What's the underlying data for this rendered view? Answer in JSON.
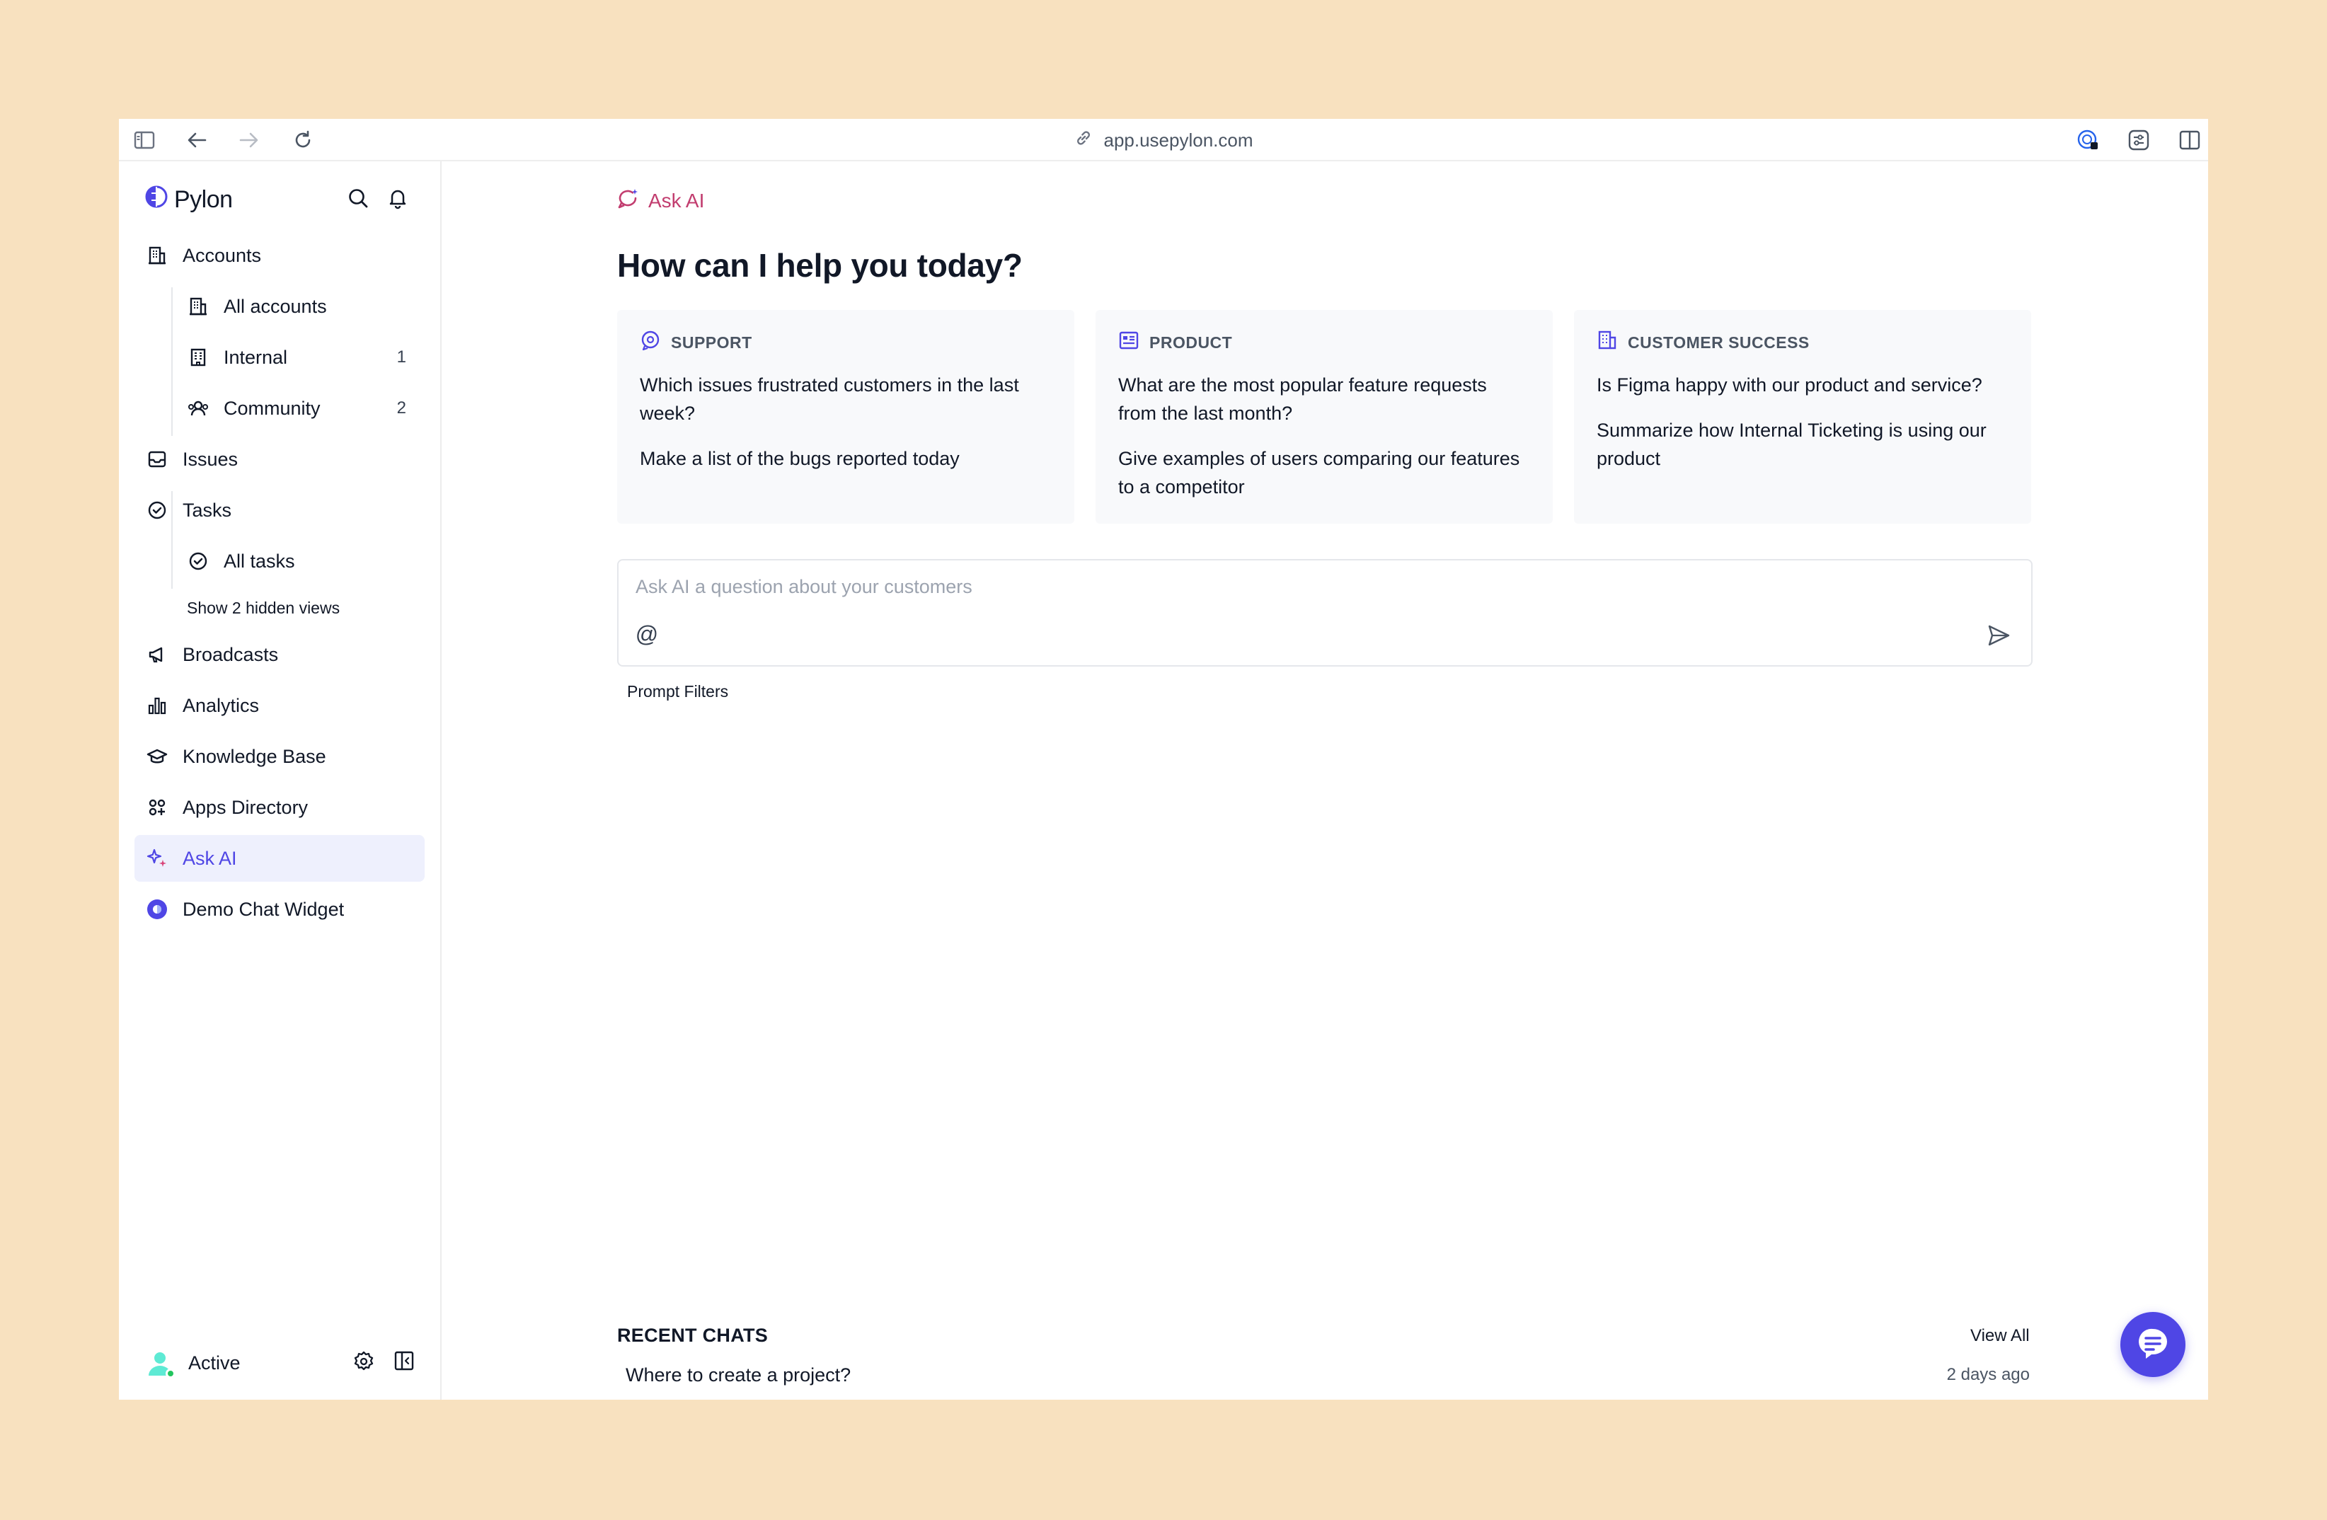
{
  "browser": {
    "url": "app.usepylon.com"
  },
  "sidebar": {
    "brand": "Pylon",
    "items": [
      {
        "label": "Accounts",
        "icon": "building-icon"
      },
      {
        "label": "All accounts",
        "icon": "building-icon"
      },
      {
        "label": "Internal",
        "icon": "office-icon",
        "count": "1"
      },
      {
        "label": "Community",
        "icon": "community-icon",
        "count": "2"
      },
      {
        "label": "Issues",
        "icon": "inbox-icon"
      },
      {
        "label": "Tasks",
        "icon": "check-circle-icon"
      },
      {
        "label": "All tasks",
        "icon": "check-circle-icon"
      },
      {
        "label": "Broadcasts",
        "icon": "megaphone-icon"
      },
      {
        "label": "Analytics",
        "icon": "bar-chart-icon"
      },
      {
        "label": "Knowledge Base",
        "icon": "graduation-cap-icon"
      },
      {
        "label": "Apps Directory",
        "icon": "apps-icon"
      },
      {
        "label": "Ask AI",
        "icon": "sparkles-icon"
      },
      {
        "label": "Demo Chat Widget",
        "icon": "chat-widget-icon"
      }
    ],
    "hidden_views": "Show 2 hidden views",
    "footer": {
      "status": "Active"
    }
  },
  "main": {
    "breadcrumb": "Ask AI",
    "headline": "How can I help you today?",
    "cards": [
      {
        "category": "SUPPORT",
        "questions": [
          "Which issues frustrated customers in the last week?",
          "Make a list of the bugs reported today"
        ]
      },
      {
        "category": "PRODUCT",
        "questions": [
          "What are the most popular feature requests from the last month?",
          "Give examples of users comparing our features to a competitor"
        ]
      },
      {
        "category": "CUSTOMER SUCCESS",
        "questions": [
          "Is Figma happy with our product and service?",
          "Summarize how Internal Ticketing is using our product"
        ]
      }
    ],
    "ask": {
      "placeholder": "Ask AI a question about your customers",
      "at_symbol": "@"
    },
    "prompt_filters": "Prompt Filters",
    "recent": {
      "title": "RECENT CHATS",
      "view_all": "View All",
      "chats": [
        {
          "title": "Where to create a project?",
          "time": "2 days ago"
        }
      ]
    }
  },
  "colors": {
    "accent": "#4f46e5",
    "ask_ai_pink": "#c23d6f",
    "background": "#f8e1bf"
  }
}
